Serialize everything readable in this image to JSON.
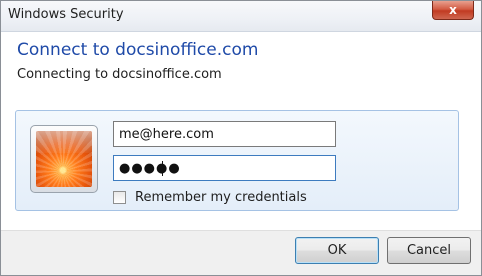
{
  "window": {
    "title": "Windows Security",
    "close_glyph": "x"
  },
  "dialog": {
    "heading": "Connect to docsinoffice.com",
    "subheading": "Connecting to docsinoffice.com"
  },
  "credentials": {
    "user_tile_icon": "user-tile-flower",
    "username_value": "me@here.com",
    "password_masked": "●●●●●",
    "remember_label": "Remember my credentials",
    "remember_checked": false
  },
  "buttons": {
    "ok_label": "OK",
    "cancel_label": "Cancel"
  },
  "colors": {
    "heading": "#1f4aa8",
    "panel_border": "#a5c2e4",
    "close_red": "#c13b22"
  }
}
